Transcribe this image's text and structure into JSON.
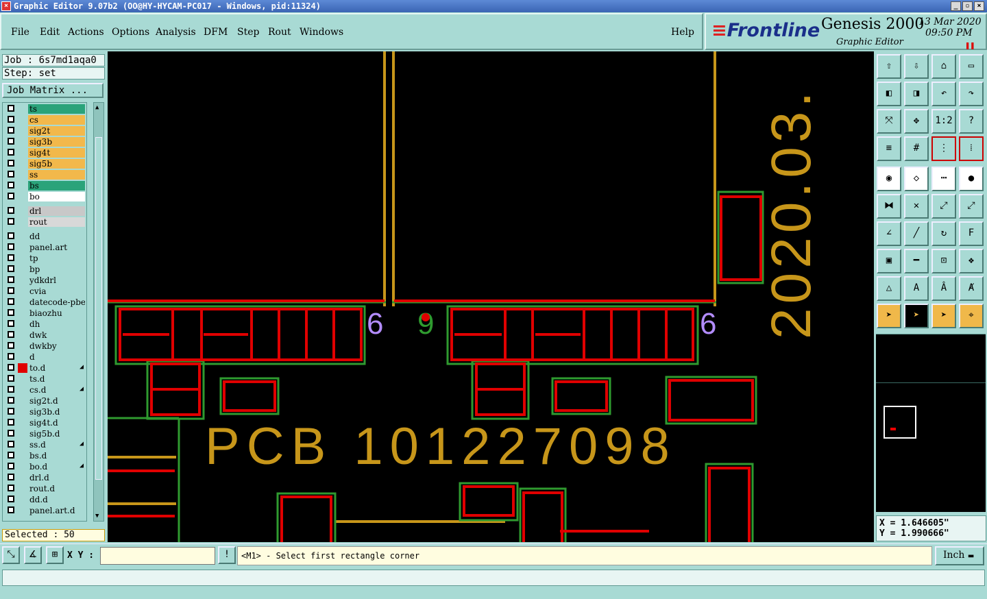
{
  "window": {
    "title": "Graphic Editor 9.07b2 (OO@HY-HYCAM-PC017 - Windows, pid:11324)",
    "controls": [
      "_",
      "▫",
      "×"
    ]
  },
  "menubar": {
    "items": [
      "File",
      "Edit",
      "Actions",
      "Options",
      "Analysis",
      "DFM",
      "Step",
      "Rout",
      "Windows"
    ],
    "help": "Help"
  },
  "logo": {
    "brand": "Frontline",
    "product": "Genesis 2000",
    "subtitle": "Graphic Editor",
    "date": "13 Mar 2020",
    "time": "09:50 PM",
    "pause_icon": "pause-icon"
  },
  "job": {
    "job_label": "Job : 6s7md1aqa0",
    "step_label": "Step: set",
    "matrix_button": "Job Matrix ..."
  },
  "layers": [
    {
      "name": "ts",
      "color": "#2aa37a",
      "group": 0
    },
    {
      "name": "cs",
      "color": "#f2b84b",
      "group": 0
    },
    {
      "name": "sig2t",
      "color": "#f2b84b",
      "group": 0
    },
    {
      "name": "sig3b",
      "color": "#f2b84b",
      "group": 0
    },
    {
      "name": "sig4t",
      "color": "#f2b84b",
      "group": 0
    },
    {
      "name": "sig5b",
      "color": "#f2b84b",
      "group": 0
    },
    {
      "name": "ss",
      "color": "#f2b84b",
      "group": 0
    },
    {
      "name": "bs",
      "color": "#2aa37a",
      "group": 0
    },
    {
      "name": "bo",
      "color": "#ffffff",
      "group": 0
    },
    {
      "name": "drl",
      "color": "#c8c8c8",
      "group": 1
    },
    {
      "name": "rout",
      "color": "#d8d8d8",
      "group": 1
    },
    {
      "name": "dd",
      "color": "#a8dad4",
      "group": 2
    },
    {
      "name": "panel.art",
      "color": "#a8dad4",
      "group": 2
    },
    {
      "name": "tp",
      "color": "#a8dad4",
      "group": 2
    },
    {
      "name": "bp",
      "color": "#a8dad4",
      "group": 2
    },
    {
      "name": "ydkdrl",
      "color": "#a8dad4",
      "group": 2
    },
    {
      "name": "cvia",
      "color": "#a8dad4",
      "group": 2
    },
    {
      "name": "datecode-pbe",
      "color": "#a8dad4",
      "group": 2
    },
    {
      "name": "biaozhu",
      "color": "#a8dad4",
      "group": 2
    },
    {
      "name": "dh",
      "color": "#a8dad4",
      "group": 2
    },
    {
      "name": "dwk",
      "color": "#a8dad4",
      "group": 2
    },
    {
      "name": "dwkby",
      "color": "#a8dad4",
      "group": 2
    },
    {
      "name": "d",
      "color": "#a8dad4",
      "group": 2
    },
    {
      "name": "to.d",
      "color": "#a8dad4",
      "group": 2,
      "marker": "#e00000",
      "edit": "◢"
    },
    {
      "name": "ts.d",
      "color": "#a8dad4",
      "group": 2
    },
    {
      "name": "cs.d",
      "color": "#a8dad4",
      "group": 2,
      "edit": "◢"
    },
    {
      "name": "sig2t.d",
      "color": "#a8dad4",
      "group": 2
    },
    {
      "name": "sig3b.d",
      "color": "#a8dad4",
      "group": 2
    },
    {
      "name": "sig4t.d",
      "color": "#a8dad4",
      "group": 2
    },
    {
      "name": "sig5b.d",
      "color": "#a8dad4",
      "group": 2
    },
    {
      "name": "ss.d",
      "color": "#a8dad4",
      "group": 2,
      "edit": "◢"
    },
    {
      "name": "bs.d",
      "color": "#a8dad4",
      "group": 2
    },
    {
      "name": "bo.d",
      "color": "#a8dad4",
      "group": 2,
      "edit": "◢"
    },
    {
      "name": "drl.d",
      "color": "#a8dad4",
      "group": 2
    },
    {
      "name": "rout.d",
      "color": "#a8dad4",
      "group": 2
    },
    {
      "name": "dd.d",
      "color": "#a8dad4",
      "group": 2
    },
    {
      "name": "panel.art.d",
      "color": "#a8dad4",
      "group": 2
    }
  ],
  "selected_label": "Selected : 50",
  "canvas": {
    "texts": [
      "PCB 101227098",
      "2020.03.",
      "6",
      "9",
      "6"
    ],
    "colors": {
      "copper": "#e00000",
      "mask": "#2f9a2f",
      "silk": "#c7961a",
      "drill": "#b38cff"
    }
  },
  "toolbox": {
    "rows": [
      [
        "home-up-icon",
        "home-down-icon",
        "home-icon",
        "frame-icon"
      ],
      [
        "pan-left-icon",
        "pan-right-icon",
        "undo-zoom-icon",
        "redo-zoom-icon"
      ],
      [
        "zoom-fit-icon",
        "zoom-center-icon",
        "1:2",
        "?"
      ],
      [
        "ruler-icon",
        "grid-icon",
        "layers-icon",
        "layers-alt-icon"
      ],
      [
        "feature-icon",
        "shape-icon",
        "measure-icon",
        "pad-icon"
      ],
      [
        "net-icon",
        "cross-icon",
        "connect-icon",
        "connect-alt-icon"
      ],
      [
        "angle-icon",
        "line-icon",
        "arc-icon",
        "font-icon"
      ],
      [
        "select-node-icon",
        "minus-icon",
        "resize-icon",
        "group-icon"
      ],
      [
        "triangle-icon",
        "text-a-icon",
        "text-a-plus-icon",
        "text-a-strike-icon"
      ],
      [
        "pointer-icon",
        "pointer-selected-icon",
        "pointer-alt-icon",
        "route-icon"
      ]
    ],
    "labels": {
      "zoom_ratio": "1:2",
      "help": "?"
    }
  },
  "coords": {
    "x": "X = 1.646605\"",
    "y": "Y = 1.990666\""
  },
  "command": {
    "xy_label": "X Y :",
    "xy_value": "",
    "prompt": "<M1> - Select first rectangle corner",
    "unit": "Inch",
    "excl": "!"
  },
  "status_text": ""
}
